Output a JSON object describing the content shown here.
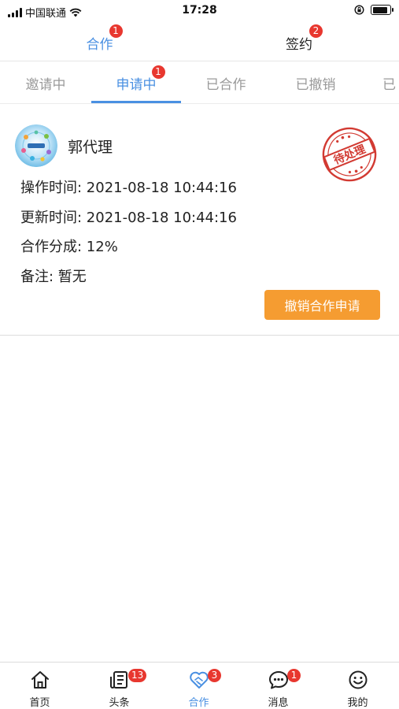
{
  "status_bar": {
    "carrier": "中国联通",
    "time": "17:28",
    "battery_level": 0.9
  },
  "top_tabs": [
    {
      "label": "合作",
      "badge": "1",
      "active": true
    },
    {
      "label": "签约",
      "badge": "2",
      "active": false
    }
  ],
  "sub_tabs": [
    {
      "label": "邀请中",
      "badge": "",
      "active": false
    },
    {
      "label": "申请中",
      "badge": "1",
      "active": true
    },
    {
      "label": "已合作",
      "badge": "",
      "active": false
    },
    {
      "label": "已撤销",
      "badge": "",
      "active": false
    },
    {
      "label": "已",
      "badge": "",
      "active": false
    }
  ],
  "card": {
    "agent_name": "郭代理",
    "stamp_text": "待处理",
    "lines": [
      "操作时间: 2021-08-18 10:44:16",
      "更新时间: 2021-08-18 10:44:16",
      "合作分成: 12%",
      "备注: 暂无"
    ],
    "action_button": "撤销合作申请"
  },
  "colors": {
    "accent": "#4a90e2",
    "badge": "#e8372f",
    "button": "#f59c31",
    "stamp": "#d23a32"
  },
  "bottom_nav": [
    {
      "label": "首页",
      "icon": "home-icon",
      "badge": ""
    },
    {
      "label": "头条",
      "icon": "news-icon",
      "badge": "13"
    },
    {
      "label": "合作",
      "icon": "handshake-heart-icon",
      "badge": "3",
      "active": true
    },
    {
      "label": "消息",
      "icon": "message-icon",
      "badge": "1"
    },
    {
      "label": "我的",
      "icon": "smile-icon",
      "badge": ""
    }
  ]
}
